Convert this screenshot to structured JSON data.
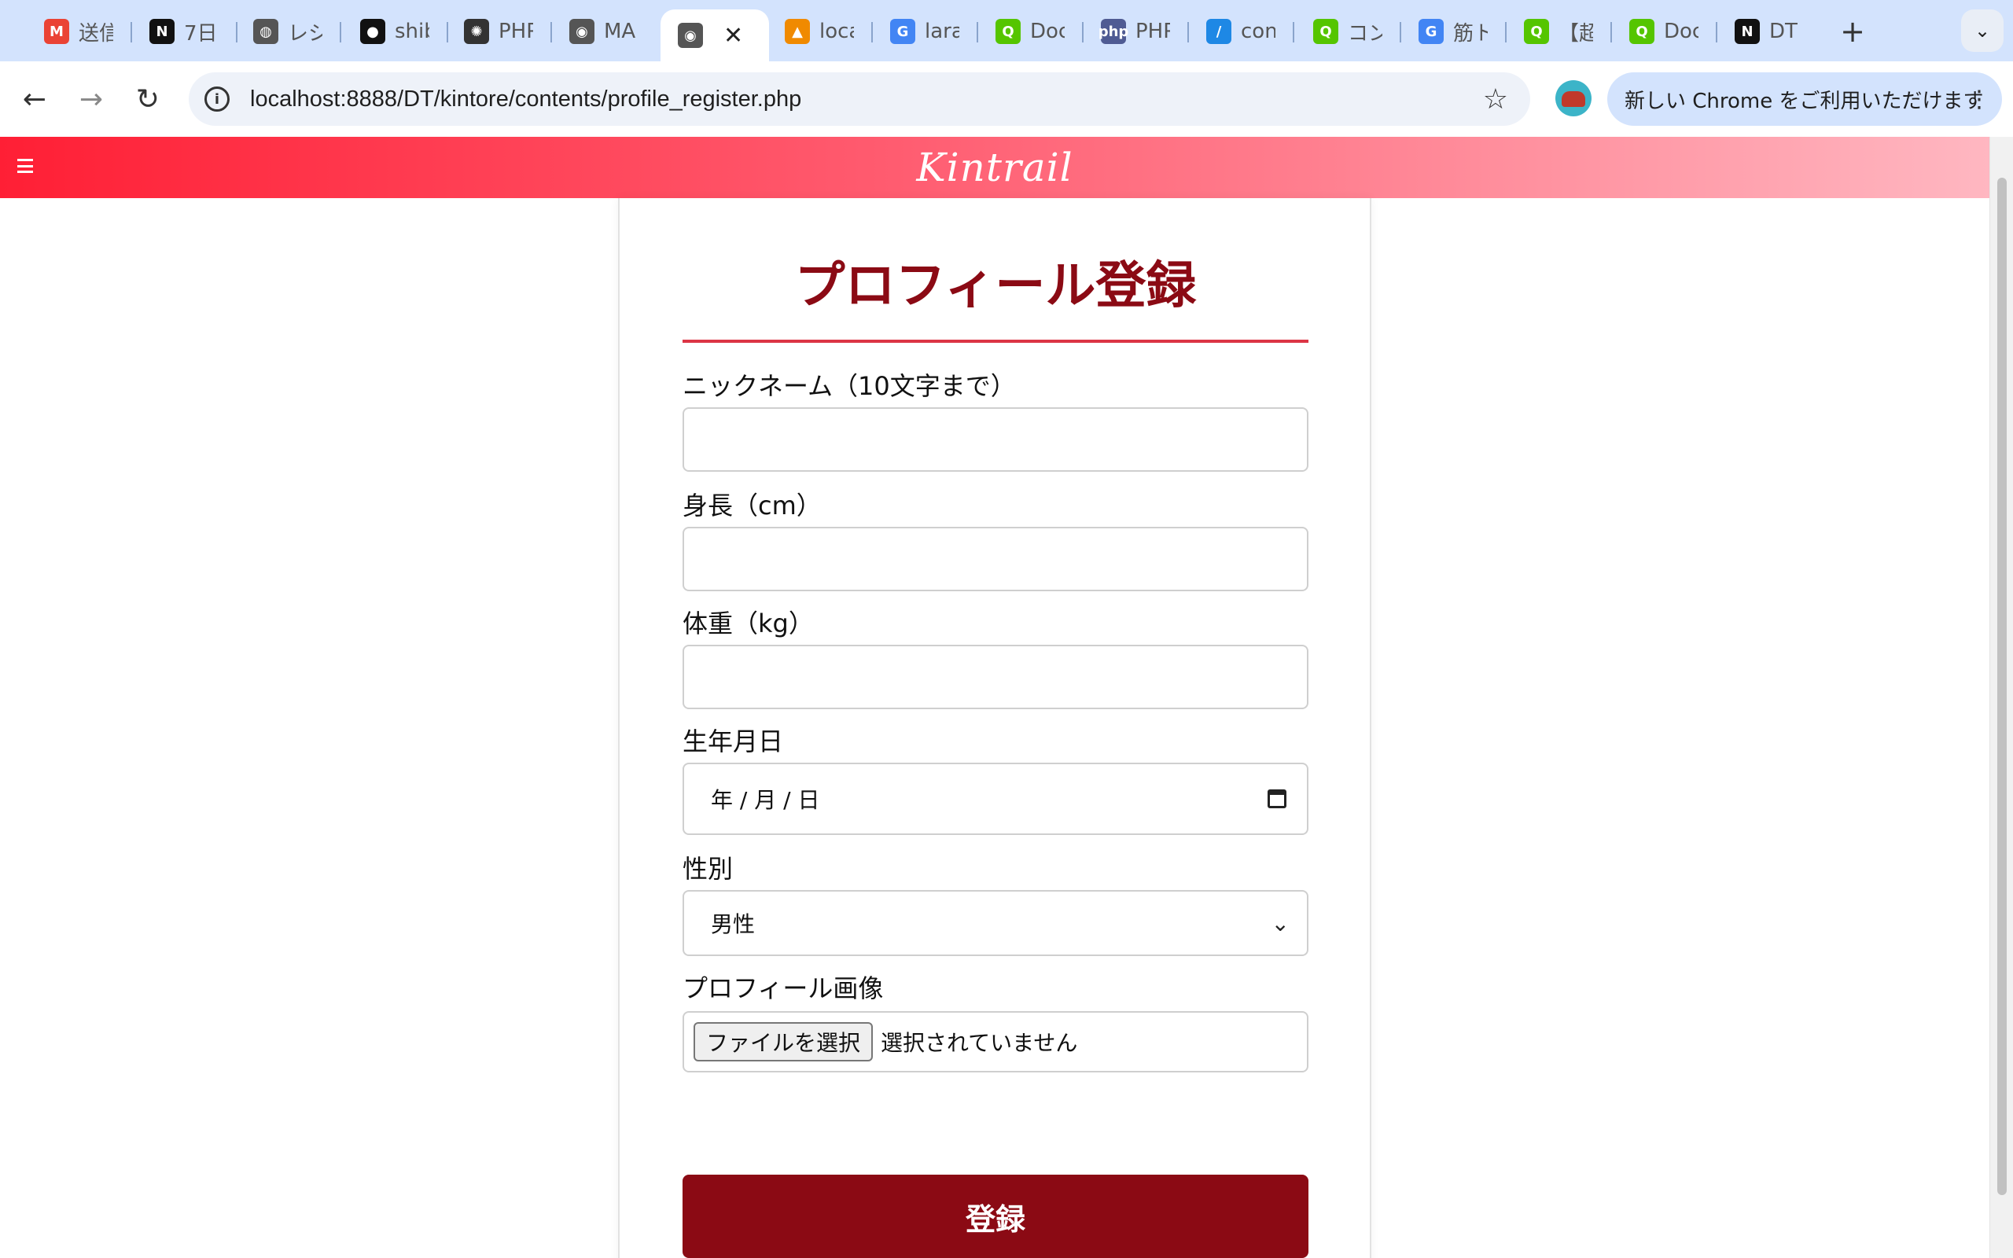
{
  "browser": {
    "tabs": [
      {
        "title": "送信",
        "icon": "gmail-icon",
        "color": "#ea4335",
        "glyph": "M"
      },
      {
        "title": "7日",
        "icon": "notion-icon",
        "color": "#111111",
        "glyph": "N"
      },
      {
        "title": "レシ",
        "icon": "globe-icon",
        "color": "#555555",
        "glyph": "◍"
      },
      {
        "title": "shib",
        "icon": "github-icon",
        "color": "#111111",
        "glyph": "●"
      },
      {
        "title": "PHP",
        "icon": "chatgpt-icon",
        "color": "#333333",
        "glyph": "✺"
      },
      {
        "title": "MA",
        "icon": "mamp-icon",
        "color": "#555555",
        "glyph": "◉"
      },
      {
        "title": "",
        "icon": "mamp-icon",
        "color": "#555555",
        "glyph": "◉",
        "active": true
      },
      {
        "title": "loca",
        "icon": "phpmyadmin-icon",
        "color": "#f08a00",
        "glyph": "▲"
      },
      {
        "title": "lara",
        "icon": "google-icon",
        "color": "#4285f4",
        "glyph": "G"
      },
      {
        "title": "Doc",
        "icon": "qiita-icon",
        "color": "#55c500",
        "glyph": "Q"
      },
      {
        "title": "PHP",
        "icon": "php-icon",
        "color": "#4f5b93",
        "glyph": "php"
      },
      {
        "title": "con",
        "icon": "cursor-icon",
        "color": "#1e88e5",
        "glyph": "/"
      },
      {
        "title": "コン",
        "icon": "qiita-icon",
        "color": "#55c500",
        "glyph": "Q"
      },
      {
        "title": "筋ト",
        "icon": "google-icon",
        "color": "#4285f4",
        "glyph": "G"
      },
      {
        "title": "【超",
        "icon": "qiita-icon",
        "color": "#55c500",
        "glyph": "Q"
      },
      {
        "title": "Doc",
        "icon": "qiita-icon",
        "color": "#55c500",
        "glyph": "Q"
      },
      {
        "title": "DT",
        "icon": "notion-icon",
        "color": "#111111",
        "glyph": "N"
      }
    ],
    "close_glyph": "✕",
    "new_tab_glyph": "+",
    "tab_search_glyph": "⌄",
    "back_glyph": "←",
    "forward_glyph": "→",
    "reload_glyph": "↻",
    "info_glyph": "i",
    "url": "localhost:8888/DT/kintore/contents/profile_register.php",
    "star_glyph": "☆",
    "update_text": "新しい Chrome をご利用いただけます",
    "menu_glyph": "⋮"
  },
  "site": {
    "logo": "Kintrail",
    "header_gradient": [
      "#ff1f35",
      "#ffb7c1"
    ]
  },
  "form": {
    "title": "プロフィール登録",
    "nickname_label": "ニックネーム（10文字まで）",
    "nickname_value": "",
    "height_label": "身長（cm）",
    "height_value": "",
    "weight_label": "体重（kg）",
    "weight_value": "",
    "birthday_label": "生年月日",
    "birthday_placeholder": "年 / 月 / 日",
    "gender_label": "性別",
    "gender_selected": "男性",
    "gender_chevron": "⌄",
    "image_label": "プロフィール画像",
    "file_button": "ファイルを選択",
    "file_status": "選択されていません",
    "submit_label": "登録"
  },
  "colors": {
    "accent": "#8b0a14",
    "rule": "#dc3545"
  }
}
